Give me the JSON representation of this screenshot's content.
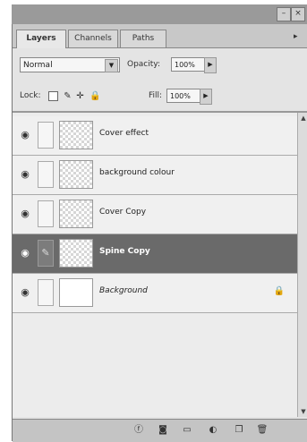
{
  "window": {
    "title_buttons": {
      "minimize": "–",
      "close": "×"
    },
    "menu_arrow": "▸"
  },
  "tabs": [
    {
      "label": "Layers",
      "active": true
    },
    {
      "label": "Channels",
      "active": false
    },
    {
      "label": "Paths",
      "active": false
    }
  ],
  "options": {
    "blend_mode": "Normal",
    "opacity_label": "Opacity:",
    "opacity_value": "100%",
    "lock_label": "Lock:",
    "fill_label": "Fill:",
    "fill_value": "100%"
  },
  "layers": [
    {
      "name": "Cover effect",
      "visible": true,
      "selected": false,
      "linked": false,
      "italic": false
    },
    {
      "name": "background colour",
      "visible": true,
      "selected": false,
      "linked": false,
      "italic": false
    },
    {
      "name": "Cover Copy",
      "visible": true,
      "selected": false,
      "linked": false,
      "italic": false
    },
    {
      "name": "Spine Copy",
      "visible": true,
      "selected": true,
      "linked": true,
      "italic": false
    },
    {
      "name": "Background",
      "visible": true,
      "selected": false,
      "linked": false,
      "italic": true,
      "locked": true
    }
  ],
  "colors": {
    "selected_row": "#6a6a6a",
    "panel_bg": "#e4e4e4",
    "titlebar": "#9a9a9a"
  },
  "icons": {
    "eye": "eye-icon",
    "brush": "paintbrush-icon",
    "lock": "lock-icon",
    "move": "move-icon",
    "transparency": "lock-transparent-icon"
  }
}
